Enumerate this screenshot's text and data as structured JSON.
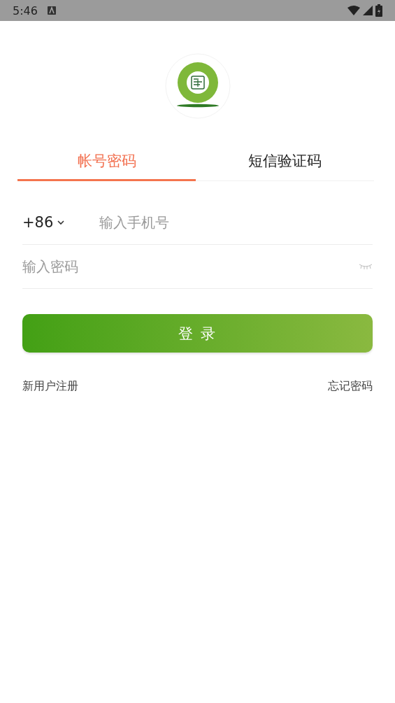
{
  "status_bar": {
    "time": "5:46"
  },
  "tabs": [
    {
      "label": "帐号密码",
      "selected": true
    },
    {
      "label": "短信验证码",
      "selected": false
    }
  ],
  "phone": {
    "country_code": "+86",
    "placeholder": "输入手机号"
  },
  "password": {
    "placeholder": "输入密码",
    "visible": false
  },
  "login_button": "登 录",
  "links": {
    "register": "新用户注册",
    "forgot": "忘记密码"
  }
}
